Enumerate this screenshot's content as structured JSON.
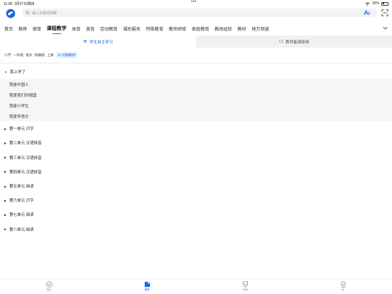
{
  "status": {
    "time": "11:09",
    "date": "3月27日周四",
    "battery": "32%",
    "battery_level": 0.32
  },
  "search": {
    "placeholder": "输入关键词搜索"
  },
  "tabs": [
    {
      "label": "首页"
    },
    {
      "label": "推荐"
    },
    {
      "label": "德育"
    },
    {
      "label": "课程教学",
      "active": true
    },
    {
      "label": "体育"
    },
    {
      "label": "美育"
    },
    {
      "label": "劳动教育"
    },
    {
      "label": "课后服务"
    },
    {
      "label": "特殊教育"
    },
    {
      "label": "教师研修"
    },
    {
      "label": "家庭教育"
    },
    {
      "label": "教改经验"
    },
    {
      "label": "教材"
    },
    {
      "label": "地方频道"
    }
  ],
  "subtabs": {
    "student": "学生自主学习",
    "teacher": "教师备课授课"
  },
  "breadcrumb": {
    "items": [
      "小学",
      "一年级",
      "语文",
      "统编版",
      "上册"
    ],
    "switch": "切换教材"
  },
  "units": [
    {
      "title": "我上学了",
      "expanded": true,
      "lessons": [
        "我是中国人",
        "我爱我们的祖国",
        "我是小学生",
        "我爱学语文"
      ]
    },
    {
      "title": "第一单元 识字"
    },
    {
      "title": "第二单元 汉语拼音"
    },
    {
      "title": "第三单元 汉语拼音"
    },
    {
      "title": "第四单元 汉语拼音"
    },
    {
      "title": "第五单元 阅读"
    },
    {
      "title": "第六单元 识字"
    },
    {
      "title": "第七单元 阅读"
    },
    {
      "title": "第八单元 阅读"
    }
  ],
  "bottomnav": {
    "home": "首页",
    "courses": "课表",
    "favorites": "收藏",
    "profile": "我"
  },
  "colors": {
    "accent": "#1a66e0",
    "muted_bg": "#f5f6f7"
  }
}
